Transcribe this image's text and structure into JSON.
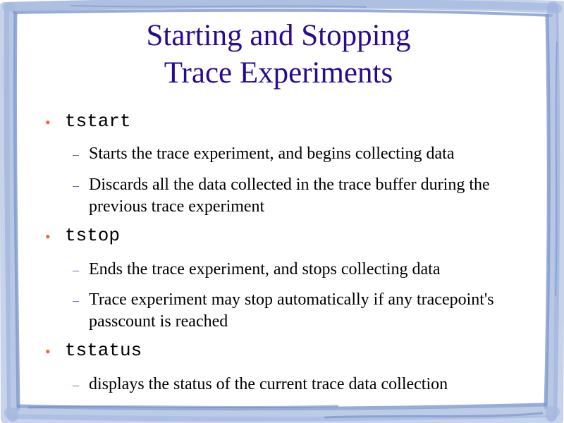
{
  "slide": {
    "title_line1": "Starting and Stopping",
    "title_line2": "Trace Experiments",
    "items": [
      {
        "command": "tstart",
        "subs": [
          "Starts the trace experiment, and begins collecting data",
          "Discards all the data collected in the trace buffer during the previous trace experiment"
        ]
      },
      {
        "command": "tstop",
        "subs": [
          "Ends the trace experiment, and stops collecting data",
          "Trace experiment may stop automatically if any tracepoint's passcount is reached"
        ]
      },
      {
        "command": "tstatus",
        "subs": [
          "displays the status of the current trace data collection"
        ]
      }
    ]
  },
  "colors": {
    "title": "#2a0a8c",
    "bullet": "#f0643a",
    "dash": "#4a64ad",
    "frame": "#7d97cc"
  }
}
